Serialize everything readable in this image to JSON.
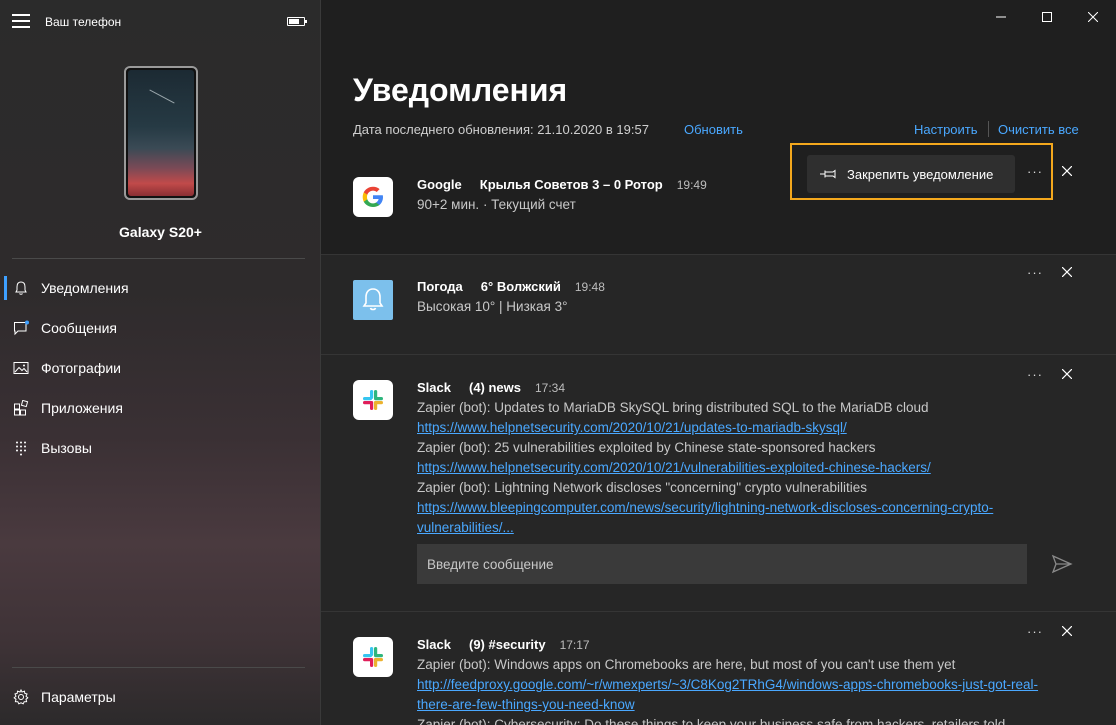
{
  "app": {
    "title": "Ваш телефон",
    "device_name": "Galaxy S20+",
    "accent": "#3ea0ff"
  },
  "nav": {
    "items": [
      {
        "label": "Уведомления",
        "icon": "bell-icon",
        "active": true
      },
      {
        "label": "Сообщения",
        "icon": "chat-icon"
      },
      {
        "label": "Фотографии",
        "icon": "photo-icon"
      },
      {
        "label": "Приложения",
        "icon": "apps-icon"
      },
      {
        "label": "Вызовы",
        "icon": "dialpad-icon"
      }
    ],
    "settings_label": "Параметры"
  },
  "main": {
    "title": "Уведомления",
    "updated": "Дата последнего обновления: 21.10.2020 в 19:57",
    "refresh": "Обновить",
    "configure": "Настроить",
    "clear_all": "Очистить все"
  },
  "pin": {
    "label": "Закрепить уведомление"
  },
  "notifications": [
    {
      "app": "Google",
      "title": "Крылья Советов 3 – 0 Ротор",
      "time": "19:49",
      "lines": [
        "90+2 мин. · Текущий счет"
      ]
    },
    {
      "app": "Погода",
      "title": "6° Волжский",
      "time": "19:48",
      "lines": [
        "Высокая 10° | Низкая 3°"
      ]
    },
    {
      "app": "Slack",
      "title": "(4) news",
      "time": "17:34",
      "lines": [
        "Zapier (bot): Updates to MariaDB SkySQL bring distributed SQL to the MariaDB cloud",
        "https://www.helpnetsecurity.com/2020/10/21/updates-to-mariadb-skysql/",
        "Zapier (bot): 25 vulnerabilities exploited by Chinese state-sponsored hackers",
        "https://www.helpnetsecurity.com/2020/10/21/vulnerabilities-exploited-chinese-hackers/",
        "Zapier (bot): Lightning Network discloses \"concerning\" crypto vulnerabilities",
        "https://www.bleepingcomputer.com/news/security/lightning-network-discloses-concerning-crypto-",
        "vulnerabilities/..."
      ],
      "reply_placeholder": "Введите сообщение"
    },
    {
      "app": "Slack",
      "title": "(9) #security",
      "time": "17:17",
      "lines": [
        "Zapier (bot): Windows apps on Chromebooks are here, but most of you can't use them yet",
        "http://feedproxy.google.com/~r/wmexperts/~3/C8Kog2TRhG4/windows-apps-chromebooks-just-got-real-",
        "there-are-few-things-you-need-know",
        "Zapier (bot): Cybersecurity: Do these things to keep your business safe from hackers, retailers told"
      ]
    }
  ],
  "more_label": "···"
}
